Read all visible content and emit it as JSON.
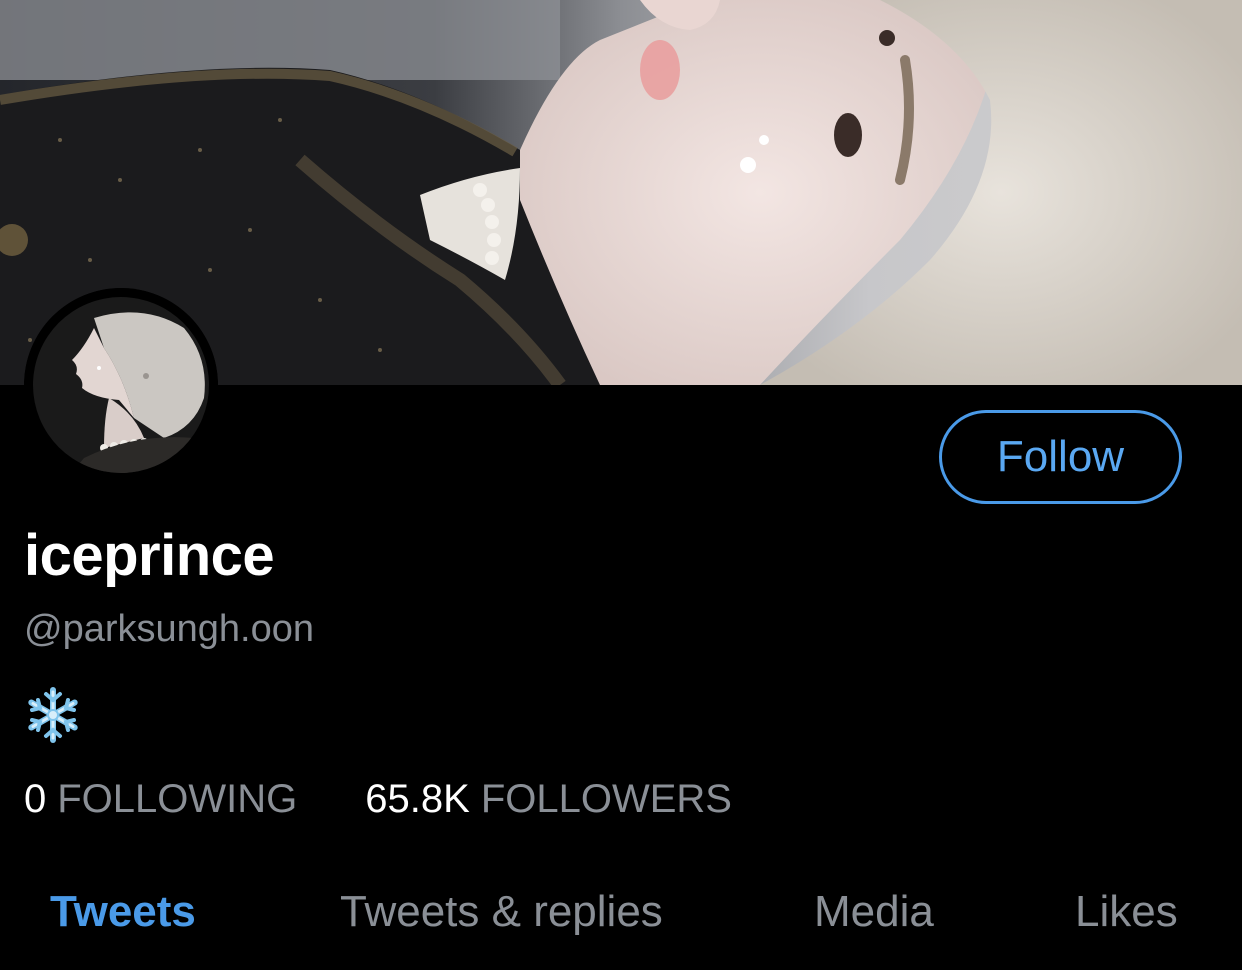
{
  "profile": {
    "display_name": "iceprince",
    "handle": "@parksungh.oon",
    "bio_icon": "snowflake-icon"
  },
  "actions": {
    "follow_label": "Follow"
  },
  "stats": {
    "following_count": "0",
    "following_label": "FOLLOWING",
    "followers_count": "65.8K",
    "followers_label": "FOLLOWERS"
  },
  "tabs": [
    {
      "label": "Tweets",
      "active": true
    },
    {
      "label": "Tweets & replies",
      "active": false
    },
    {
      "label": "Media",
      "active": false
    },
    {
      "label": "Likes",
      "active": false
    }
  ],
  "colors": {
    "background": "#000000",
    "accent": "#4a9ae8",
    "secondary_text": "#8a8f96",
    "primary_text": "#ffffff"
  }
}
